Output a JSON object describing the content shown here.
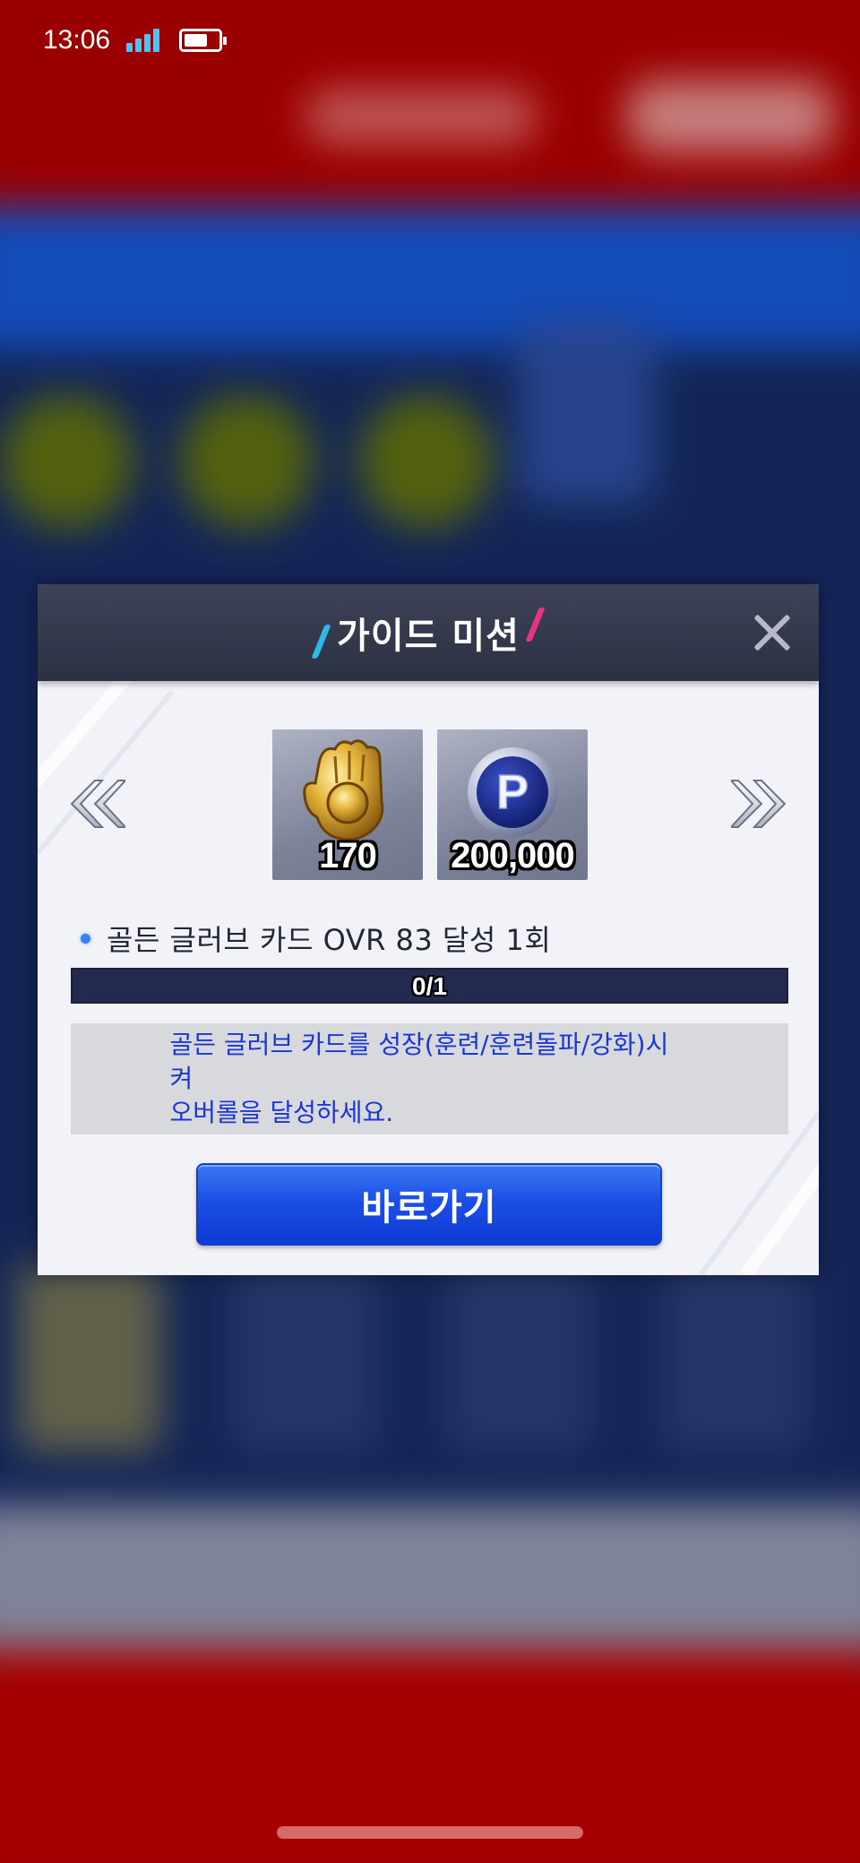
{
  "status_bar": {
    "time": "13:06",
    "signal_icon": "signal-bars-icon",
    "battery_icon": "battery-icon",
    "battery_level": 0.7
  },
  "dialog": {
    "title": "가이드 미션",
    "close_icon": "close-x-icon",
    "prev_icon": "double-chevron-left-icon",
    "next_icon": "double-chevron-right-icon",
    "rewards": [
      {
        "icon": "golden-glove-icon",
        "amount": "170"
      },
      {
        "icon": "p-point-coin-icon",
        "amount": "200,000"
      }
    ],
    "mission": "골든 글러브 카드 OVR 83 달성 1회",
    "progress": {
      "text": "0/1",
      "current": 0,
      "total": 1
    },
    "description": "골든 글러브 카드를 성장(훈련/훈련돌파/강화)시켜\n오버롤을 달성하세요.",
    "go_button": "바로가기"
  },
  "colors": {
    "header_bg": "#2c3043",
    "dialog_bg": "#f1f3f9",
    "progress_bg": "#23294f",
    "description_text": "#1a36d8",
    "button_blue": "#1c4fe6",
    "accent_pink": "#e8337e",
    "accent_cyan": "#2fb7ea"
  }
}
